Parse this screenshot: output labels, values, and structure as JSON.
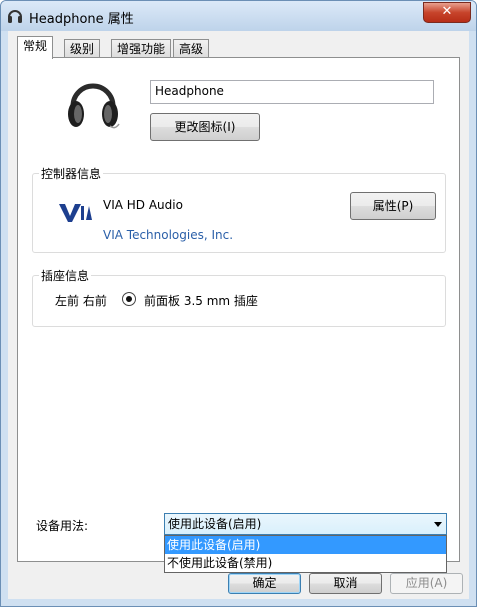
{
  "window": {
    "title": "Headphone 属性",
    "close_label": "✕"
  },
  "tabs": [
    {
      "label": "常规",
      "active": true
    },
    {
      "label": "级别",
      "active": false
    },
    {
      "label": "增强功能",
      "active": false
    },
    {
      "label": "高级",
      "active": false
    }
  ],
  "device": {
    "name": "Headphone",
    "change_icon_button": "更改图标(I)"
  },
  "controller": {
    "group_title": "控制器信息",
    "name": "VIA HD Audio",
    "vendor": "VIA Technologies, Inc.",
    "properties_button": "属性(P)",
    "logo_text": "VIA"
  },
  "jack": {
    "group_title": "插座信息",
    "channels": "左前 右前",
    "description": "前面板 3.5 mm 插座"
  },
  "usage": {
    "label": "设备用法:",
    "selected": "使用此设备(启用)",
    "options": [
      "使用此设备(启用)",
      "不使用此设备(禁用)"
    ]
  },
  "footer": {
    "ok": "确定",
    "cancel": "取消",
    "apply": "应用(A)"
  }
}
